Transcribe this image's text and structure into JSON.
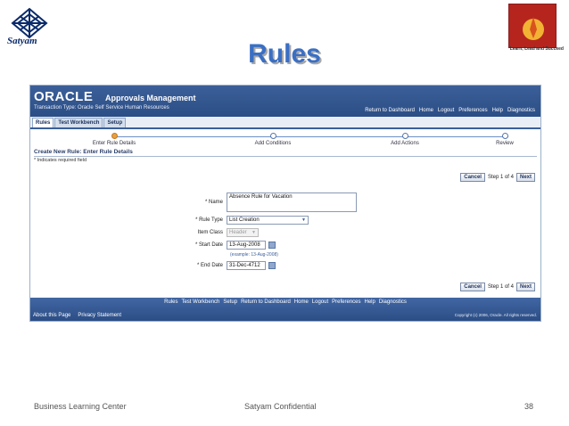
{
  "slide": {
    "title": "Rules",
    "brand_text": "Satyam",
    "blc_tag": "Learn, Lead and Succeed",
    "footer_left": "Business Learning Center",
    "footer_center": "Satyam Confidential",
    "page_number": "38"
  },
  "app": {
    "logo": "ORACLE",
    "title": "Approvals Management",
    "transaction_type": "Transaction Type: Oracle Self Service Human Resources",
    "global_links": [
      "Return to Dashboard",
      "Home",
      "Logout",
      "Preferences",
      "Help",
      "Diagnostics"
    ],
    "tabs": [
      {
        "label": "Rules",
        "active": true
      },
      {
        "label": "Test Workbench",
        "active": false
      },
      {
        "label": "Setup",
        "active": false
      }
    ],
    "train": [
      {
        "label": "Enter Rule Details",
        "current": true
      },
      {
        "label": "Add Conditions",
        "current": false
      },
      {
        "label": "Add Actions",
        "current": false
      },
      {
        "label": "Review",
        "current": false
      }
    ],
    "region_title": "Create New Rule: Enter Rule Details",
    "required_note": "* Indicates required field",
    "buttons": {
      "cancel": "Cancel",
      "step": "Step 1 of 4",
      "next": "Next"
    },
    "form": {
      "name_label": "* Name",
      "name_value": "Absence Rule for Vacation",
      "rule_type_label": "* Rule Type",
      "rule_type_value": "List Creation",
      "item_class_label": "Item Class",
      "item_class_value": "Header",
      "start_date_label": "* Start Date",
      "start_date_value": "13-Aug-2008",
      "date_hint": "(example: 13-Aug-2008)",
      "end_date_label": "* End Date",
      "end_date_value": "31-Dec-4712"
    },
    "footer_links": [
      "Rules",
      "Test Workbench",
      "Setup",
      "Return to Dashboard",
      "Home",
      "Logout",
      "Preferences",
      "Help",
      "Diagnostics"
    ],
    "footer_left_links": [
      "About this Page",
      "Privacy Statement"
    ],
    "copyright": "Copyright (c) 2006, Oracle. All rights reserved."
  },
  "colors": {
    "title_blue": "#3a6fc4",
    "oracle_header": "#2c4e86",
    "train_current": "#e8a040"
  }
}
